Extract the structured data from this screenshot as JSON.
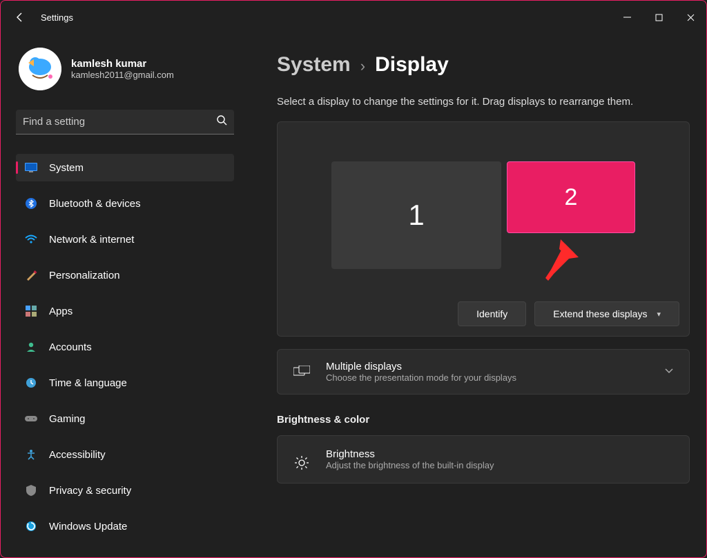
{
  "titlebar": {
    "title": "Settings"
  },
  "profile": {
    "name": "kamlesh kumar",
    "email": "kamlesh2011@gmail.com"
  },
  "search": {
    "placeholder": "Find a setting"
  },
  "nav": {
    "items": [
      {
        "label": "System"
      },
      {
        "label": "Bluetooth & devices"
      },
      {
        "label": "Network & internet"
      },
      {
        "label": "Personalization"
      },
      {
        "label": "Apps"
      },
      {
        "label": "Accounts"
      },
      {
        "label": "Time & language"
      },
      {
        "label": "Gaming"
      },
      {
        "label": "Accessibility"
      },
      {
        "label": "Privacy & security"
      },
      {
        "label": "Windows Update"
      }
    ]
  },
  "breadcrumb": {
    "parent": "System",
    "sep": "›",
    "current": "Display"
  },
  "display": {
    "hint": "Select a display to change the settings for it. Drag displays to rearrange them.",
    "monitor1": "1",
    "monitor2": "2",
    "identify": "Identify",
    "mode": "Extend these displays"
  },
  "multiple": {
    "title": "Multiple displays",
    "sub": "Choose the presentation mode for your displays"
  },
  "section_brightness": "Brightness & color",
  "brightness": {
    "title": "Brightness",
    "sub": "Adjust the brightness of the built-in display"
  }
}
